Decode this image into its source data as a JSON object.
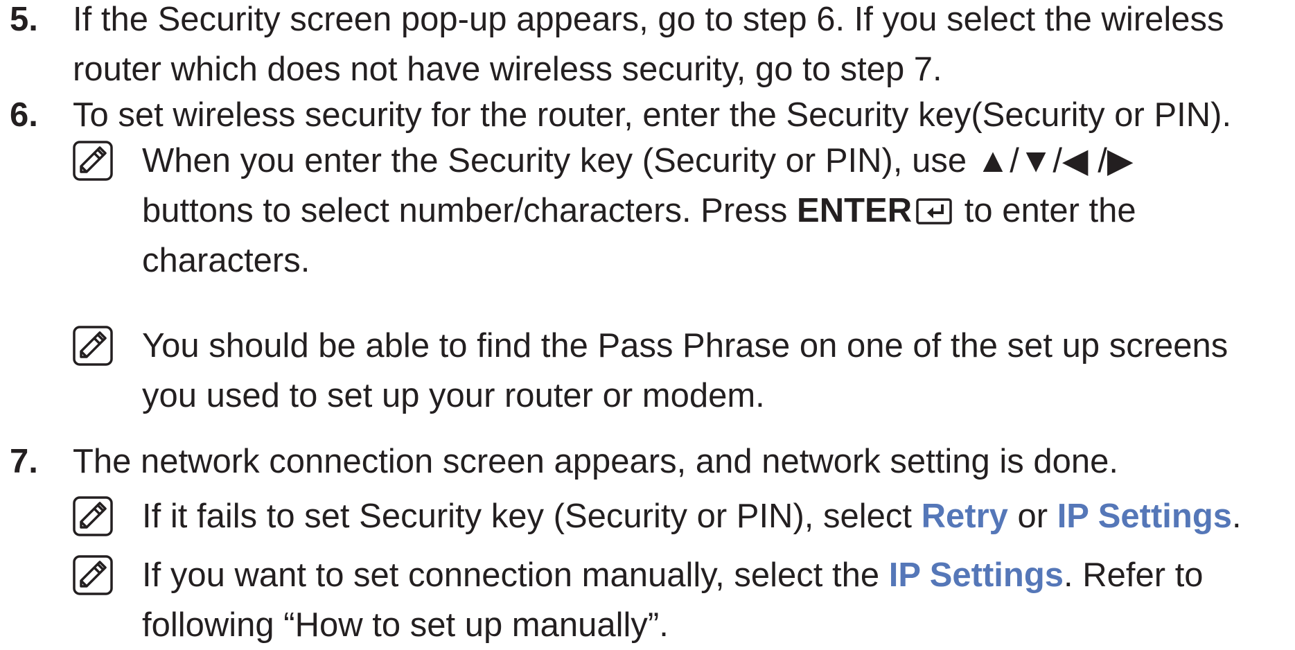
{
  "steps": [
    {
      "number": "5.",
      "lines": [
        "If the Security screen pop-up appears, go to step 6. If you select the wireless",
        "router which does not have wireless security, go to step 7."
      ]
    },
    {
      "number": "6.",
      "lines": [
        "To set wireless security for the router, enter the Security key(Security or PIN)."
      ],
      "notes": [
        {
          "line1": "When you enter the Security key (Security or PIN), use ▲/▼/◀ /▶",
          "line2_before": "buttons to select number/characters. Press ",
          "line2_bold": "ENTER",
          "line2_after": " to enter the",
          "line3": "characters."
        },
        {
          "line1": "You should be able to find the Pass Phrase on one of the set up screens",
          "line2": "you used to set up your router or modem."
        }
      ]
    },
    {
      "number": "7.",
      "lines": [
        "The network connection screen appears, and network setting is done."
      ],
      "notes": [
        {
          "before": "If it fails to set Security key (Security or PIN), select ",
          "link1": "Retry",
          "middle": " or ",
          "link2": "IP Settings",
          "after": "."
        },
        {
          "before": "If you want to set connection manually, select the ",
          "link": "IP Settings",
          "after": ". Refer to",
          "line2": "following “How to set up manually”."
        }
      ]
    }
  ],
  "colors": {
    "text": "#231f20",
    "highlight": "#5577b8"
  },
  "icons": {
    "note": "note-icon",
    "enter": "enter-key-icon"
  }
}
